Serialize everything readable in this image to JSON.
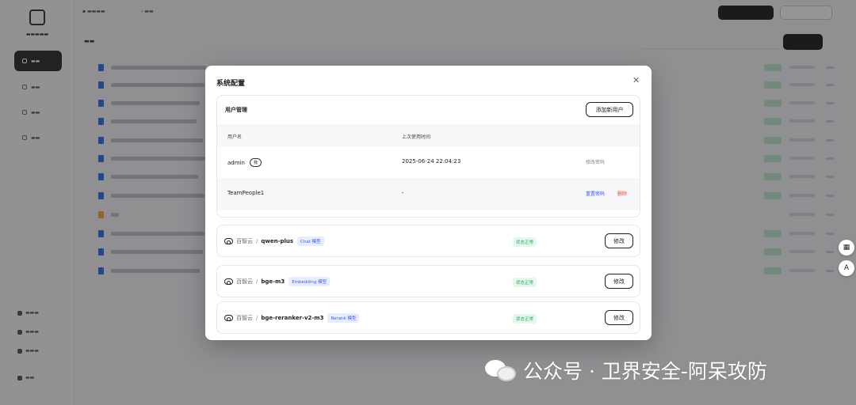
{
  "modal": {
    "title": "系统配置",
    "close_icon": "close-icon",
    "user_management": {
      "title": "用户管理",
      "add_user_label": "添加新用户",
      "columns": [
        "用户名",
        "上次使用时间"
      ],
      "rows": [
        {
          "username": "admin",
          "badge": "我",
          "last_used": "2025-06-24 22:04:23",
          "actions": [
            "修改密码"
          ]
        },
        {
          "username": "TeamPeople1",
          "badge": "",
          "last_used": "-",
          "actions": [
            "重置密码",
            "删除"
          ]
        }
      ]
    },
    "models": [
      {
        "provider": "百智云",
        "separator": "/",
        "name": "qwen-plus",
        "tag": "Chat 模型",
        "status": "状态正常",
        "edit_label": "修改"
      },
      {
        "provider": "百智云",
        "separator": "/",
        "name": "bge-m3",
        "tag": "Embedding 模型",
        "status": "状态正常",
        "edit_label": "修改"
      },
      {
        "provider": "百智云",
        "separator": "/",
        "name": "bge-reranker-v2-m3",
        "tag": "Rerank 模型",
        "status": "状态正常",
        "edit_label": "修改"
      }
    ]
  },
  "watermark": {
    "text": "公众号 · 卫界安全-阿呆攻防"
  },
  "colors": {
    "accent_blue": "#2e5bff",
    "danger_red": "#f04040",
    "status_green": "#2ea664",
    "dark": "#1f1f1f"
  },
  "icons": {
    "provider": "cloud-icon",
    "watermark": "wechat-icon",
    "float_1": "qr-icon",
    "float_2": "translate-icon"
  }
}
